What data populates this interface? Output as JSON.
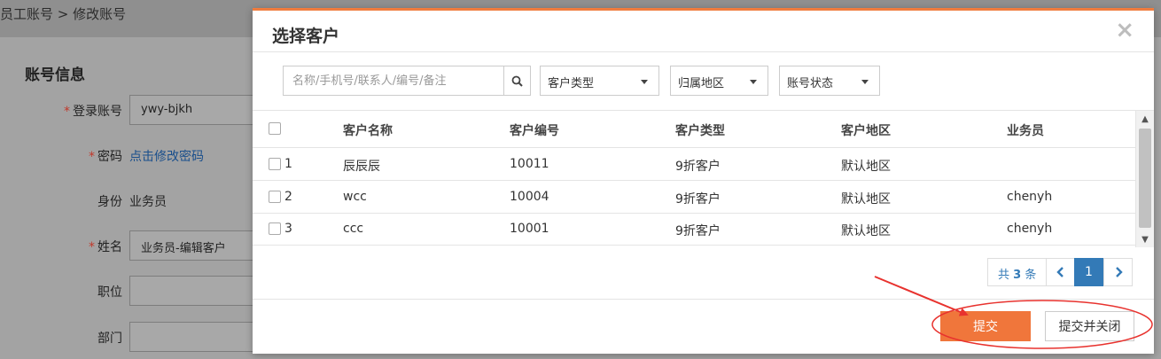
{
  "background": {
    "breadcrumb": "员工账号 > 修改账号",
    "section_title": "账号信息",
    "fields": {
      "login": {
        "label": "登录账号",
        "value": "ywy-bjkh"
      },
      "password": {
        "label": "密码",
        "value": "点击修改密码"
      },
      "identity": {
        "label": "身份",
        "value": "业务员"
      },
      "name": {
        "label": "姓名",
        "value": "业务员-编辑客户"
      },
      "position": {
        "label": "职位",
        "value": ""
      },
      "department": {
        "label": "部门",
        "value": ""
      }
    },
    "required_mark": "*"
  },
  "modal": {
    "title": "选择客户",
    "close_glyph": "×",
    "search": {
      "placeholder": "名称/手机号/联系人/编号/备注",
      "value": ""
    },
    "filters": {
      "customer_type": "客户类型",
      "region": "归属地区",
      "account_status": "账号状态"
    },
    "table": {
      "columns": [
        "客户名称",
        "客户编号",
        "客户类型",
        "客户地区",
        "业务员"
      ],
      "rows": [
        {
          "num": "1",
          "name": "辰辰辰",
          "code": "10011",
          "type": "9折客户",
          "region": "默认地区",
          "salesperson": ""
        },
        {
          "num": "2",
          "name": "wcc",
          "code": "10004",
          "type": "9折客户",
          "region": "默认地区",
          "salesperson": "chenyh"
        },
        {
          "num": "3",
          "name": "ccc",
          "code": "10001",
          "type": "9折客户",
          "region": "默认地区",
          "salesperson": "chenyh"
        }
      ]
    },
    "pager": {
      "prefix": "共",
      "total": "3",
      "suffix": "条",
      "current_page": "1"
    },
    "buttons": {
      "submit": "提交",
      "submit_close": "提交并关闭"
    }
  },
  "colors": {
    "accent": "#f0763b",
    "annotation": "#e8322e",
    "link": "#337ab7"
  }
}
